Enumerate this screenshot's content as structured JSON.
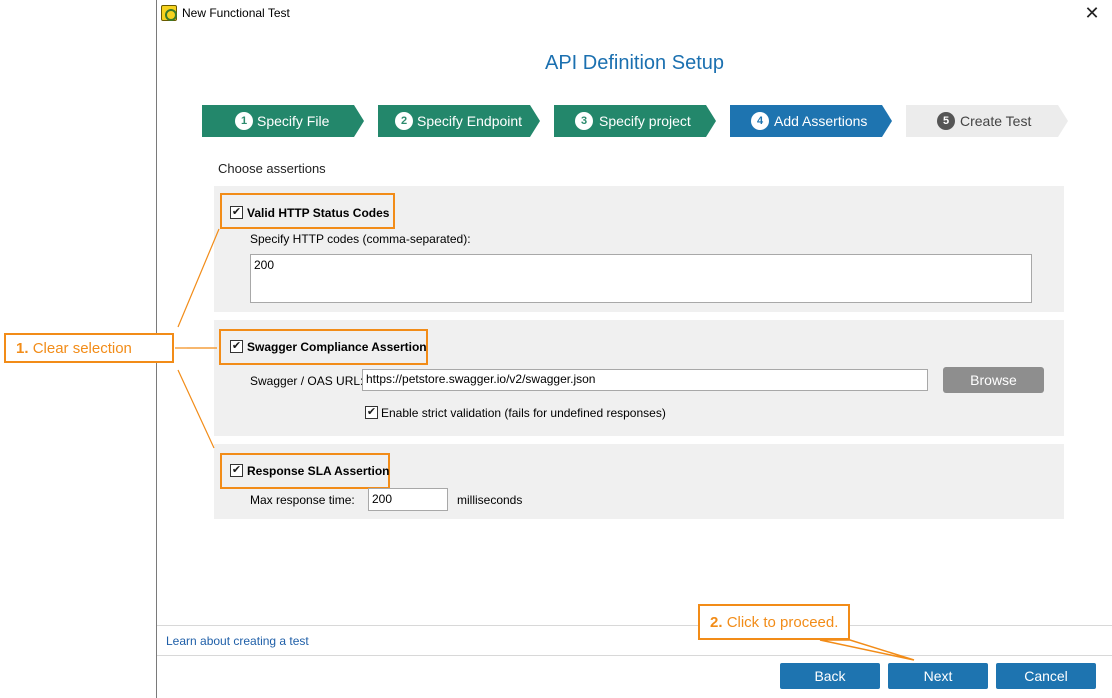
{
  "window": {
    "title": "New Functional Test",
    "close": "✕"
  },
  "header": {
    "title": "API Definition Setup"
  },
  "steps": [
    {
      "num": "1",
      "label": "Specify File",
      "state": "done"
    },
    {
      "num": "2",
      "label": "Specify Endpoint",
      "state": "done"
    },
    {
      "num": "3",
      "label": "Specify project",
      "state": "done"
    },
    {
      "num": "4",
      "label": "Add Assertions",
      "state": "active"
    },
    {
      "num": "5",
      "label": "Create Test",
      "state": "todo"
    }
  ],
  "choose_label": "Choose assertions",
  "http_status": {
    "checked": true,
    "label": "Valid HTTP Status Codes",
    "codes_label": "Specify HTTP codes (comma-separated):",
    "codes_value": "200"
  },
  "swagger": {
    "checked": true,
    "label": "Swagger Compliance Assertion",
    "url_label": "Swagger / OAS URL:",
    "url_value": "https://petstore.swagger.io/v2/swagger.json",
    "browse_label": "Browse",
    "strict_checked": true,
    "strict_label": "Enable strict validation (fails for undefined responses)"
  },
  "sla": {
    "checked": true,
    "label": "Response SLA Assertion",
    "max_label": "Max response time:",
    "max_value": "200",
    "unit": "milliseconds"
  },
  "footer": {
    "learn_link": "Learn about creating a test",
    "back": "Back",
    "next": "Next",
    "cancel": "Cancel"
  },
  "annotations": {
    "step1_num": "1.",
    "step1_text": "Clear selection",
    "step2_num": "2.",
    "step2_text": "Click to proceed."
  },
  "colors": {
    "accent": "#1e74b0",
    "step_done": "#23876b",
    "annotation": "#f28c18"
  }
}
